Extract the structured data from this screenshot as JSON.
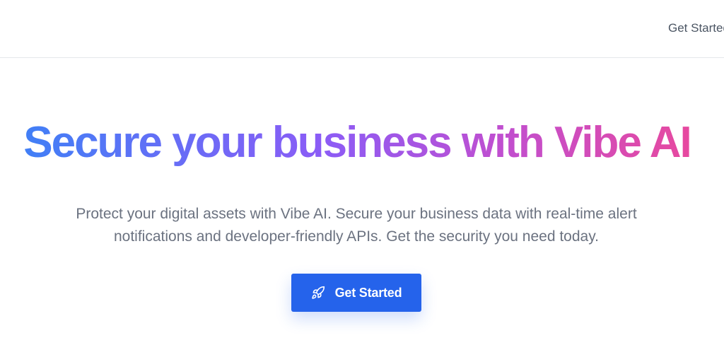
{
  "header": {
    "nav_link_label": "Get Started"
  },
  "hero": {
    "title": "Secure your business with Vibe AI",
    "description": "Protect your digital assets with Vibe AI. Secure your business data with real-time alert notifications and developer-friendly APIs. Get the security you need today.",
    "cta": {
      "label": "Get Started",
      "icon": "rocket-icon"
    }
  },
  "colors": {
    "gradient_start": "#3b82f6",
    "gradient_mid": "#8b5cf6",
    "gradient_end": "#ec4899",
    "cta_background": "#2563eb",
    "text_muted": "#6b7280"
  }
}
